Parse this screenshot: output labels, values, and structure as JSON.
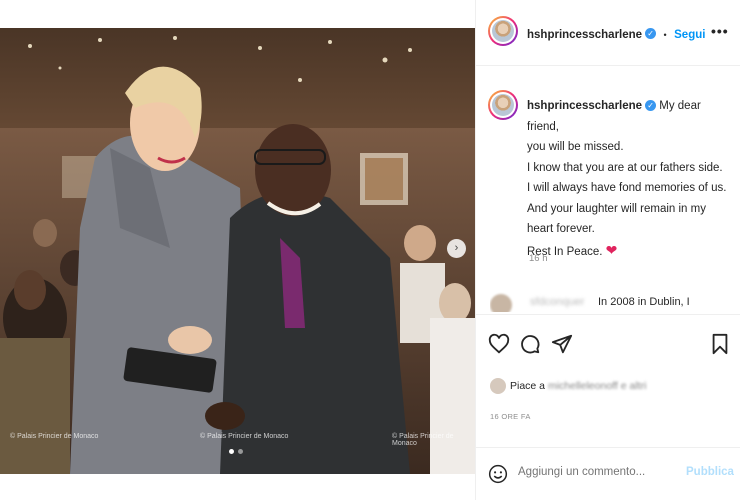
{
  "post": {
    "watermarks": [
      "© Palais Princier de Monaco",
      "© Palais Princier de Monaco",
      "© Palais Princier de Monaco"
    ],
    "carousel": {
      "next_glyph": "›",
      "total_slides": 2,
      "active_index": 0
    }
  },
  "header": {
    "username": "hshprincesscharlene",
    "separator": "•",
    "follow_label": "Segui",
    "more_glyph": "•••"
  },
  "caption": {
    "username": "hshprincesscharlene",
    "lines": [
      "My dear friend,",
      "you will be missed.",
      "I know that you are at our fathers side.",
      "I will always have fond memories of us.",
      "And your laughter will remain in my",
      "heart forever.",
      "Rest In Peace."
    ],
    "heart": "❤",
    "time": "16 h"
  },
  "comment_preview": {
    "username": "sfdconquer",
    "text": "In 2008 in Dublin, I"
  },
  "actions": {
    "icons": [
      "heart-icon",
      "comment-icon",
      "share-icon",
      "bookmark-icon"
    ]
  },
  "likes": {
    "prefix": "Piace a",
    "blurred": "michelleleonoff",
    "suffix": "e altri"
  },
  "timestamp": "16 ORE FA",
  "add_comment": {
    "placeholder": "Aggiungi un commento...",
    "publish_label": "Pubblica"
  },
  "colors": {
    "accent": "#0095f6",
    "verified": "#3897f0",
    "heart": "#e0245e",
    "muted": "#8e8e8e"
  }
}
